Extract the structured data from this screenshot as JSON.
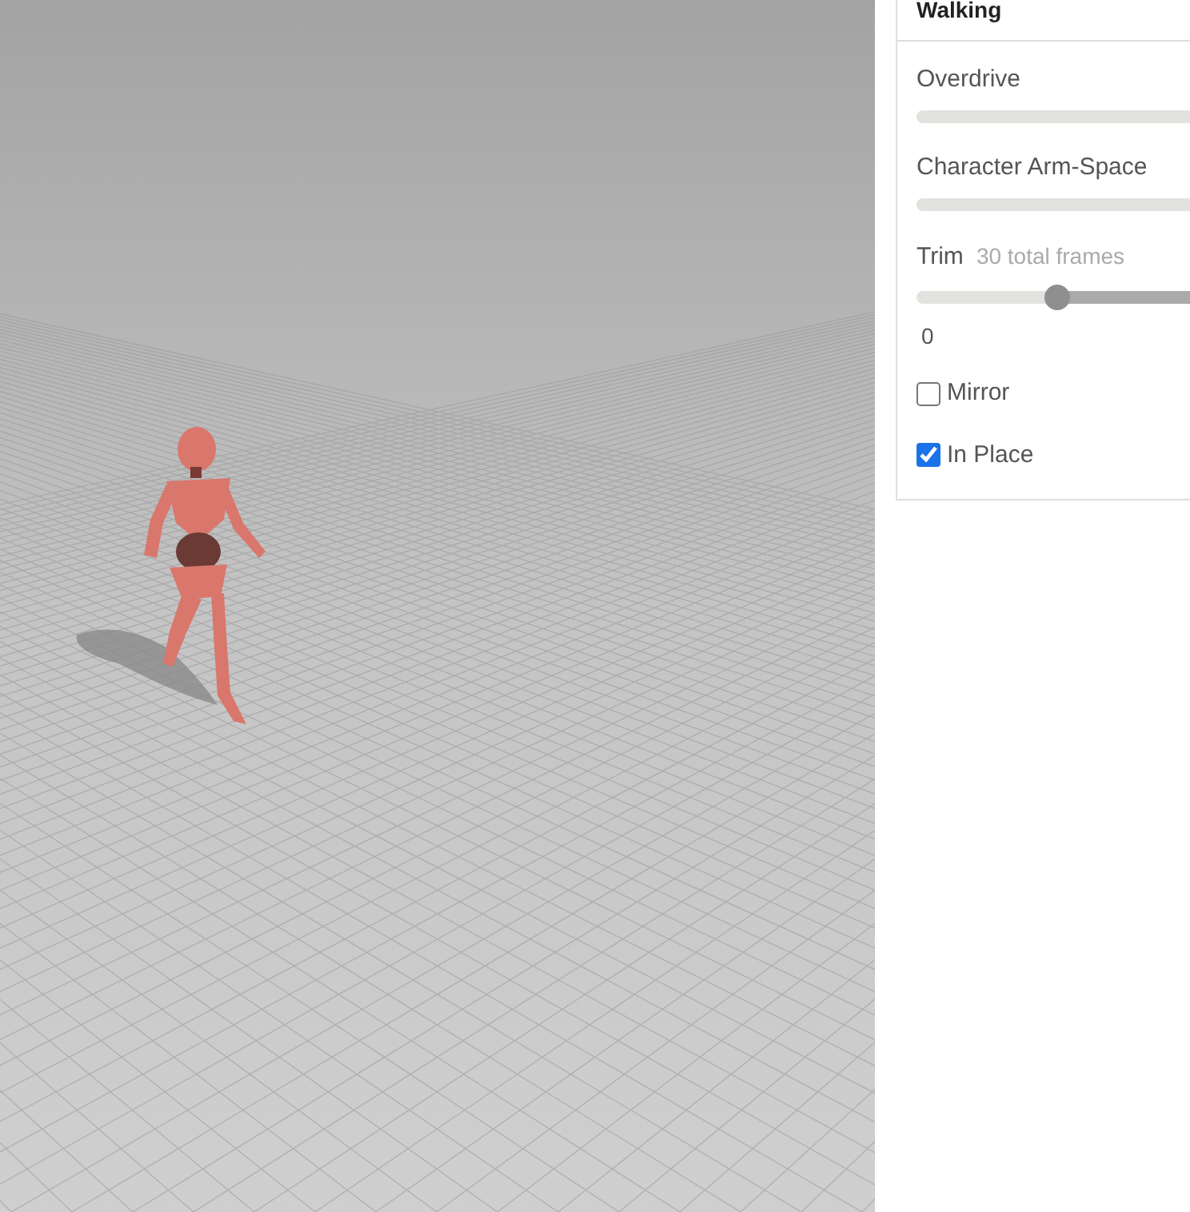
{
  "panel": {
    "title": "Walking",
    "sliders": [
      {
        "label": "Overdrive",
        "level": 0
      },
      {
        "label": "Character Arm-Space",
        "level": 0
      }
    ],
    "trim": {
      "label": "Trim",
      "note": "30 total frames",
      "level": 0.5,
      "reading": "0"
    },
    "options": [
      {
        "label": "Mirror",
        "checked": false
      },
      {
        "label": "In Place",
        "checked": true
      }
    ]
  }
}
